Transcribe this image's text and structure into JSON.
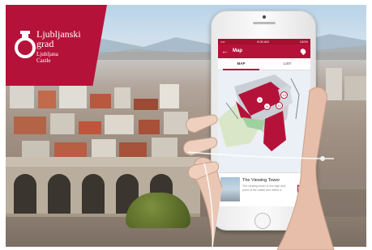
{
  "brand": {
    "title_line1": "Ljubljanski",
    "title_line2": "grad",
    "subtitle_line1": "Ljubljana",
    "subtitle_line2": "Castle",
    "color": "#b5123a"
  },
  "phone": {
    "status": {
      "carrier": "••••",
      "time": "9:00 AM",
      "battery": "100%"
    },
    "app_bar": {
      "back_icon": "arrow-left-icon",
      "title": "Map",
      "action_icon": "location-pin-icon"
    },
    "tabs": [
      {
        "label": "MAP",
        "active": true
      },
      {
        "label": "LIST",
        "active": false
      }
    ],
    "map_markers": [
      "5",
      "8",
      "11",
      "13"
    ],
    "card": {
      "title": "The Viewing Tower",
      "description": "The viewing tower is the high and point of the castle and offers a",
      "play_icon": "play-icon"
    }
  }
}
